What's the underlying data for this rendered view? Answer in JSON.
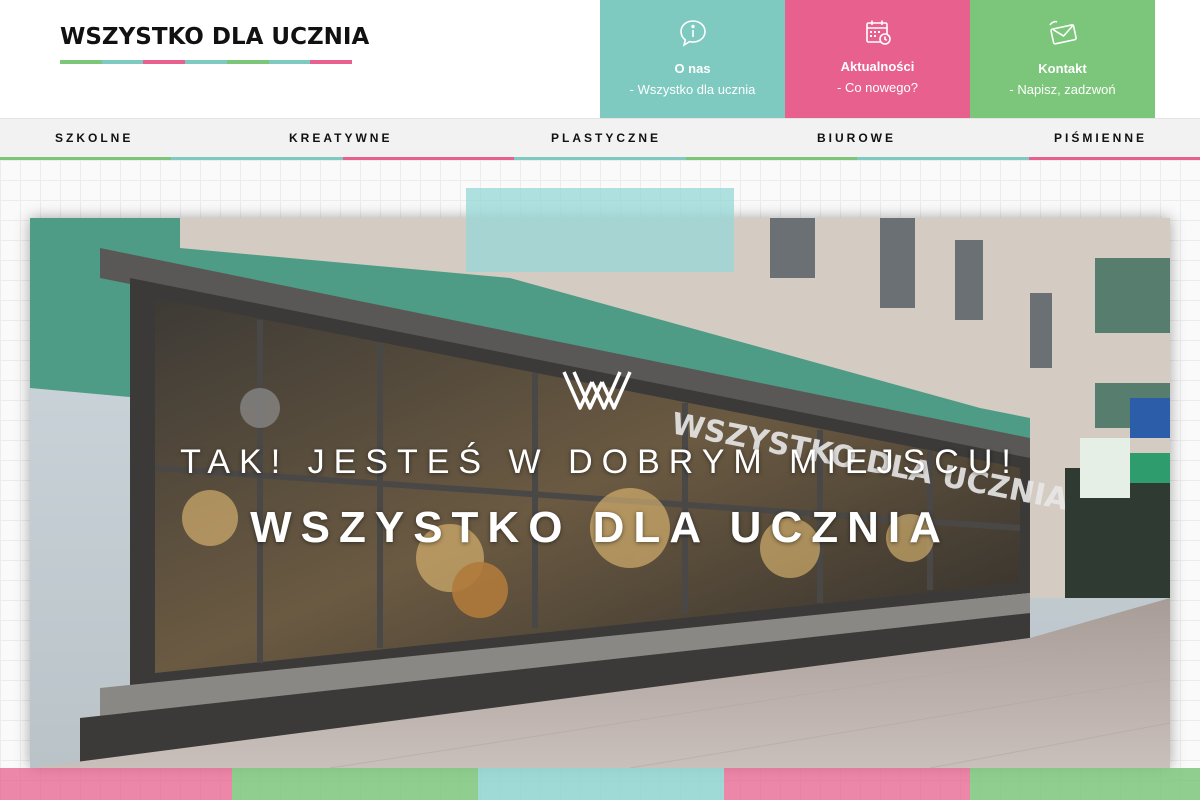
{
  "brand": {
    "logo_text": "WSZYSTKO DLA UCZNIA"
  },
  "colors": {
    "teal": "#7ecac1",
    "pink": "#e8608e",
    "green": "#7bc67b",
    "light_teal": "#8fd3cf"
  },
  "header_tiles": [
    {
      "icon": "speech-info-icon",
      "title": "O nas",
      "subtitle": "- Wszystko dla ucznia",
      "color": "#7ecac1"
    },
    {
      "icon": "calendar-icon",
      "title": "Aktualności",
      "subtitle": "- Co nowego?",
      "color": "#e8608e"
    },
    {
      "icon": "envelope-icon",
      "title": "Kontakt",
      "subtitle": "- Napisz, zadzwoń",
      "color": "#7bc67b"
    }
  ],
  "nav": {
    "items": [
      "SZKOLNE",
      "KREATYWNE",
      "PLASTYCZNE",
      "BIUROWE",
      "PIŚMIENNE"
    ]
  },
  "hero": {
    "tagline": "TAK! JESTEŚ W DOBRYM MIEJSCU!",
    "headline": "WSZYSTKO DLA UCZNIA",
    "store_sign": "WSZYSTKO DLA UCZNIA",
    "emblem_icon": "paperclip-w-icon"
  }
}
